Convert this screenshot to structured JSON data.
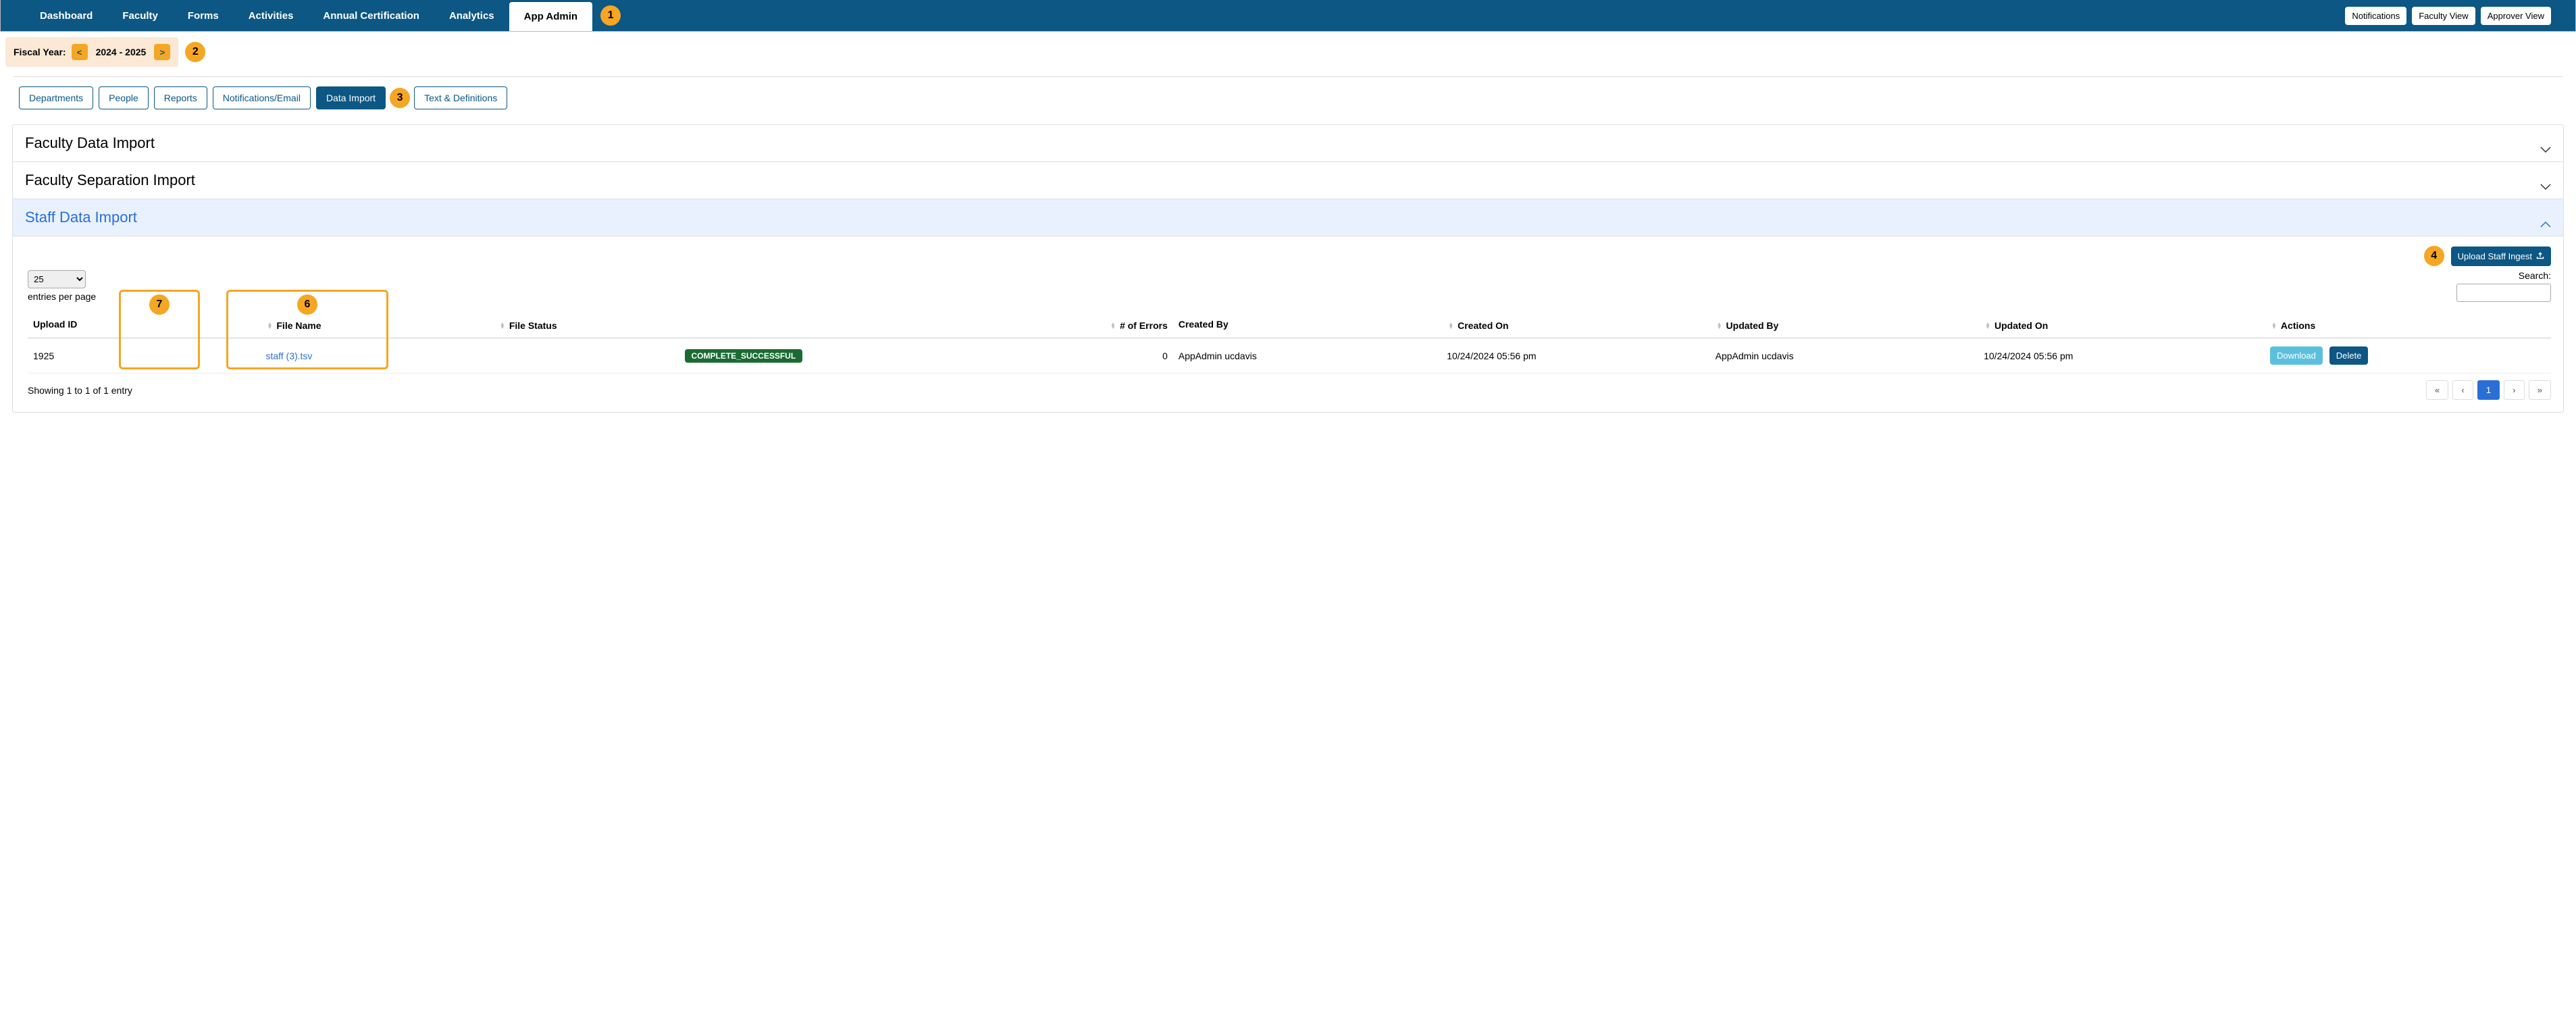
{
  "topnav": {
    "items": [
      {
        "label": "Dashboard"
      },
      {
        "label": "Faculty"
      },
      {
        "label": "Forms"
      },
      {
        "label": "Activities"
      },
      {
        "label": "Annual Certification"
      },
      {
        "label": "Analytics"
      },
      {
        "label": "App Admin"
      }
    ],
    "right_buttons": [
      {
        "label": "Notifications"
      },
      {
        "label": "Faculty View"
      },
      {
        "label": "Approver View"
      }
    ]
  },
  "markers": {
    "m1": "1",
    "m2": "2",
    "m3": "3",
    "m4": "4",
    "m6": "6",
    "m7": "7"
  },
  "fiscal": {
    "label": "Fiscal Year:",
    "prev": "<",
    "year": "2024 - 2025",
    "next": ">"
  },
  "subtabs": [
    {
      "label": "Departments"
    },
    {
      "label": "People"
    },
    {
      "label": "Reports"
    },
    {
      "label": "Notifications/Email"
    },
    {
      "label": "Data Import"
    },
    {
      "label": "Text & Definitions"
    }
  ],
  "panels": {
    "p1": {
      "title": "Faculty Data Import"
    },
    "p2": {
      "title": "Faculty Separation Import"
    },
    "p3": {
      "title": "Staff Data Import"
    }
  },
  "upload": {
    "label": "Upload Staff Ingest"
  },
  "entries": {
    "selected": "25",
    "label": "entries per page"
  },
  "search": {
    "label": "Search:",
    "value": ""
  },
  "columns": {
    "c0": "Upload ID",
    "c1": "File Name",
    "c2": "File Status",
    "c3": "# of Errors",
    "c4": "Created By",
    "c5": "Created On",
    "c6": "Updated By",
    "c7": "Updated On",
    "c8": "Actions"
  },
  "rows": [
    {
      "upload_id": "1925",
      "file_name": "staff (3).tsv",
      "file_status": "COMPLETE_SUCCESSFUL",
      "num_errors": "0",
      "created_by": "AppAdmin ucdavis",
      "created_on": "10/24/2024 05:56 pm",
      "updated_by": "AppAdmin ucdavis",
      "updated_on": "10/24/2024 05:56 pm",
      "download": "Download",
      "delete": "Delete"
    }
  ],
  "footer": {
    "showing": "Showing 1 to 1 of 1 entry",
    "pager": {
      "first": "«",
      "prev": "‹",
      "page": "1",
      "next": "›",
      "last": "»"
    }
  }
}
